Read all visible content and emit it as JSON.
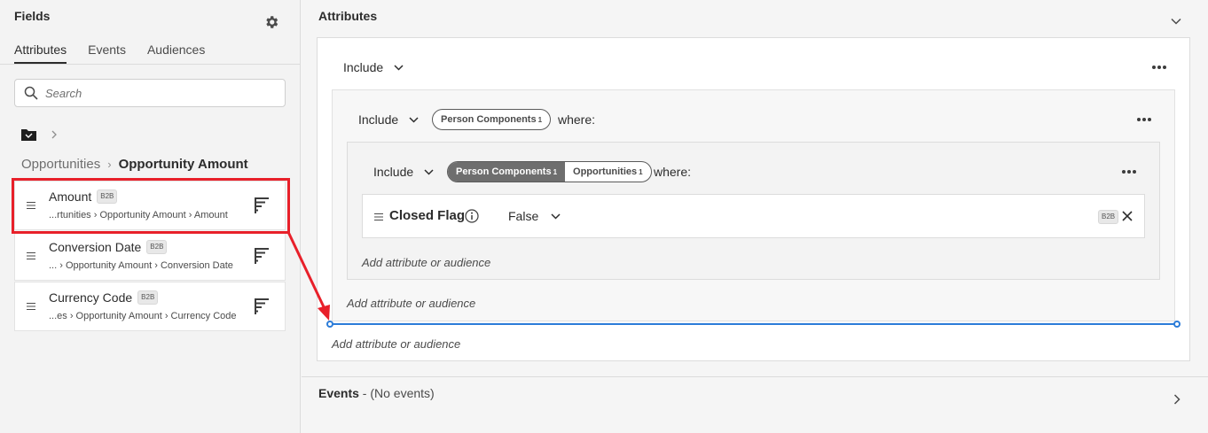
{
  "left_panel": {
    "title": "Fields",
    "tabs": [
      {
        "label": "Attributes",
        "active": true
      },
      {
        "label": "Events",
        "active": false
      },
      {
        "label": "Audiences",
        "active": false
      }
    ],
    "search_placeholder": "Search",
    "breadcrumb": {
      "parent": "Opportunities",
      "current": "Opportunity Amount"
    },
    "fields": [
      {
        "name": "Amount",
        "badge": "B2B",
        "path": "...rtunities › Opportunity Amount › Amount"
      },
      {
        "name": "Conversion Date",
        "badge": "B2B",
        "path": "... › Opportunity Amount › Conversion Date"
      },
      {
        "name": "Currency Code",
        "badge": "B2B",
        "path": "...es › Opportunity Amount › Currency Code"
      }
    ]
  },
  "attributes": {
    "title": "Attributes",
    "level1": {
      "include_label": "Include",
      "add_label": "Add attribute or audience"
    },
    "level2": {
      "include_label": "Include",
      "pill": "Person Components",
      "pill_count": "1",
      "where": "where:",
      "add_label": "Add attribute or audience"
    },
    "level3": {
      "include_label": "Include",
      "pills": [
        {
          "label": "Person Components",
          "count": "1",
          "selected": true
        },
        {
          "label": "Opportunities",
          "count": "1",
          "selected": false
        }
      ],
      "where": "where:",
      "add_label": "Add attribute or audience",
      "condition": {
        "name": "Closed Flag",
        "value": "False",
        "badge": "B2B"
      }
    }
  },
  "events": {
    "title": "Events",
    "subtitle": " - (No events)"
  },
  "colors": {
    "highlight": "#e8202a",
    "drop_line": "#2c7cd8"
  }
}
